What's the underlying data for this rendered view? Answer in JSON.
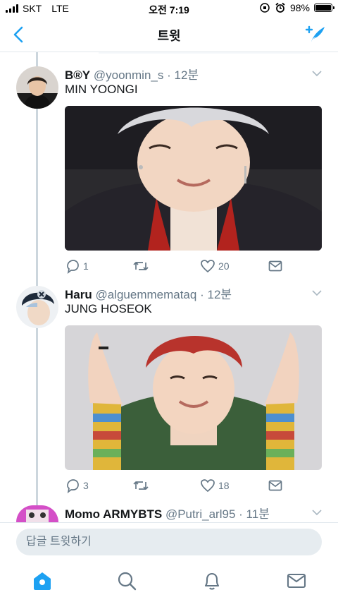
{
  "status_bar": {
    "carrier": "SKT",
    "network": "LTE",
    "time": "오전 7:19",
    "battery_percent": "98%",
    "battery_level": 0.98
  },
  "nav": {
    "title": "트윗",
    "back_icon": "chevron-left-icon",
    "compose_icon": "compose-tweet-icon"
  },
  "tweets": [
    {
      "name": "B®Y",
      "handle": "@yoonmin_s",
      "separator": "·",
      "time": "12분",
      "text": "MIN YOONGI",
      "replies": "1",
      "retweets": "",
      "likes": "20"
    },
    {
      "name": "Haru",
      "handle": "@alguemmemataq",
      "separator": "·",
      "time": "12분",
      "text": "JUNG HOSEOK",
      "replies": "3",
      "retweets": "",
      "likes": "18"
    },
    {
      "name": "Momo ARMYBTS",
      "handle": "@Putri_arl95",
      "separator": "·",
      "time": "11분"
    }
  ],
  "reply": {
    "placeholder": "답글 트윗하기"
  },
  "tabs": [
    {
      "icon": "home-icon",
      "active": true
    },
    {
      "icon": "search-icon",
      "active": false
    },
    {
      "icon": "bell-icon",
      "active": false
    },
    {
      "icon": "mail-icon",
      "active": false
    }
  ],
  "colors": {
    "accent": "#1da1f2",
    "muted": "#657786",
    "divider": "#e1e8ed",
    "thread_line": "#ccd6dd"
  }
}
